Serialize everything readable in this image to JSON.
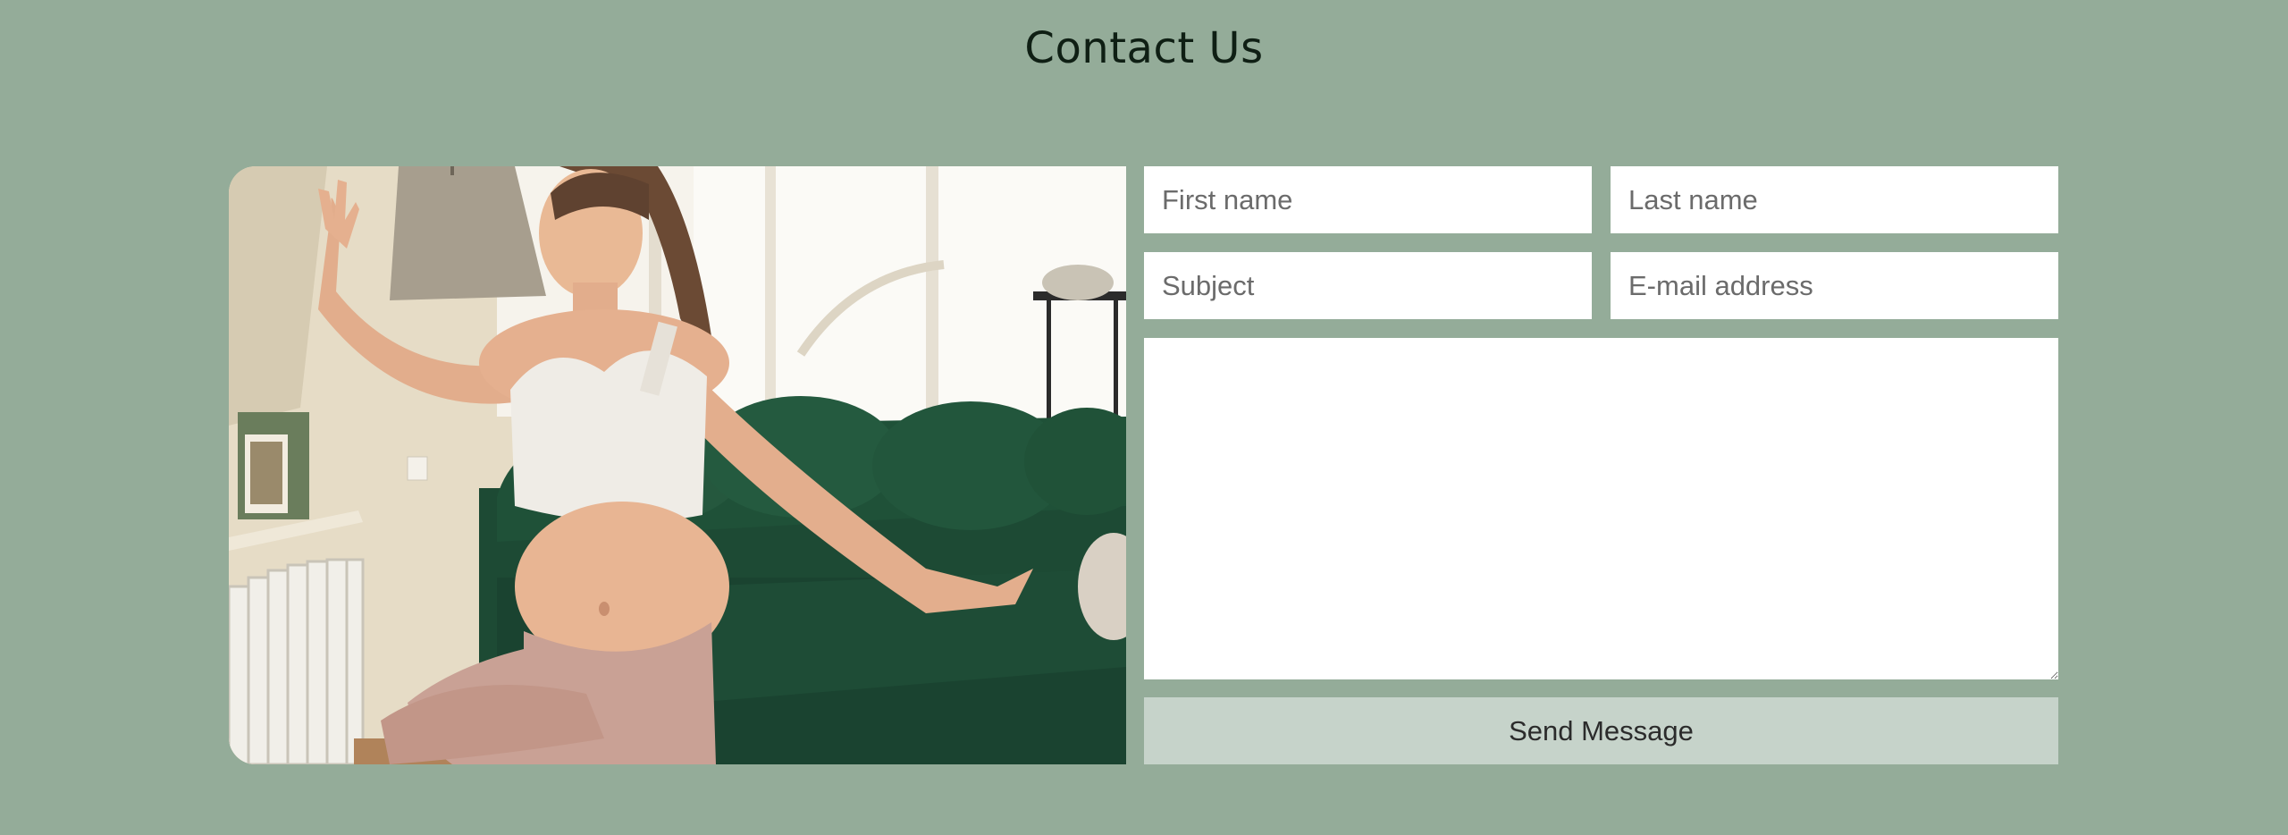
{
  "header": {
    "title": "Contact Us"
  },
  "form": {
    "first_name_placeholder": "First name",
    "last_name_placeholder": "Last name",
    "subject_placeholder": "Subject",
    "email_placeholder": "E-mail address",
    "message_placeholder": "",
    "send_label": "Send Message"
  },
  "colors": {
    "background": "#94ac99",
    "title": "#0f1f14",
    "button_bg": "#c6d3ca",
    "field_bg": "#ffffff"
  },
  "photo": {
    "subject": "pregnant-woman-yoga-living-room-photo"
  }
}
